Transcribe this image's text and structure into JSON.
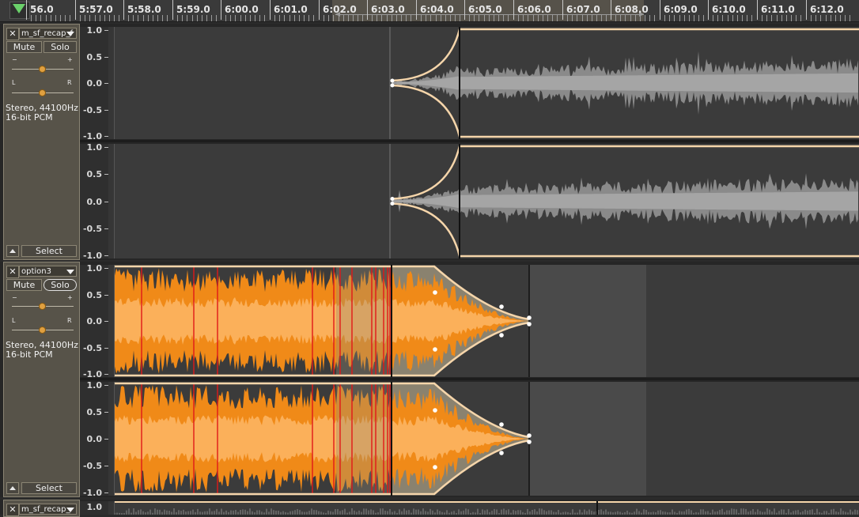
{
  "ruler": {
    "labels": [
      "56.0",
      "5:57.0",
      "5:58.0",
      "5:59.0",
      "6:00.0",
      "6:01.0",
      "6:02.0",
      "6:03.0",
      "6:04.0",
      "6:05.0",
      "6:06.0",
      "6:07.0",
      "6:08.0",
      "6:09.0",
      "6:10.0",
      "6:11.0",
      "6:12.0"
    ]
  },
  "tracks": [
    {
      "name": "m_sf_recap_f",
      "mute_label": "Mute",
      "solo_label": "Solo",
      "pan_left": "L",
      "pan_right": "R",
      "gain_minus": "−",
      "gain_plus": "+",
      "format": "Stereo, 44100Hz\n16-bit PCM",
      "select_label": "Select",
      "scale": [
        "1.0",
        "0.5",
        "0.0",
        "-0.5",
        "-1.0"
      ],
      "color": "#8e8e8e"
    },
    {
      "name": "option3",
      "mute_label": "Mute",
      "solo_label": "Solo",
      "pan_left": "L",
      "pan_right": "R",
      "gain_minus": "−",
      "gain_plus": "+",
      "format": "Stereo, 44100Hz\n16-bit PCM",
      "select_label": "Select",
      "scale": [
        "1.0",
        "0.5",
        "0.0",
        "-0.5",
        "-1.0"
      ],
      "color": "#f39a2a"
    },
    {
      "name": "m_sf_recap_",
      "scale": [
        "1.0"
      ],
      "color": "#8e8e8e"
    }
  ],
  "colors": {
    "envelope": "#f5d5aa",
    "clipping": "#e01818",
    "orange_light": "#fbb05a",
    "orange_dark": "#f08a18",
    "gray_wave": "#8a8a8a",
    "gray_wave_rms": "#a5a5a5"
  },
  "icons": [
    "play-indicator-icon",
    "close-icon",
    "dropdown-arrow-icon",
    "collapse-arrow-icon"
  ]
}
